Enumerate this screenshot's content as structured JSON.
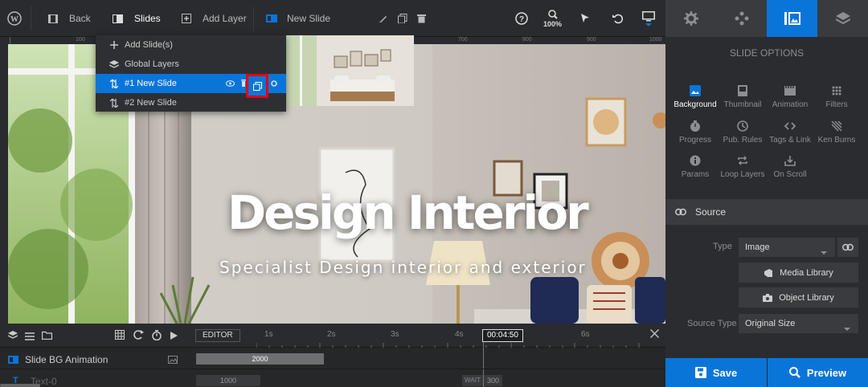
{
  "toolbar": {
    "back_label": "Back",
    "slides_label": "Slides",
    "add_layer_label": "Add Layer",
    "new_slide_label": "New Slide",
    "zoom_level": "100%"
  },
  "ruler": {
    "top_ticks": [
      "100",
      "700",
      "800",
      "900",
      "1000"
    ]
  },
  "slides_menu": {
    "items": [
      {
        "label": "Add Slide(s)"
      },
      {
        "label": "Global Layers"
      },
      {
        "label": "#1 New Slide"
      },
      {
        "label": "#2 New Slide"
      }
    ]
  },
  "canvas": {
    "headline": "Design Interior",
    "subline": "Specialist Design interior and exterior"
  },
  "timeline": {
    "editor_label": "EDITOR",
    "ticks": [
      "1s",
      "2s",
      "3s",
      "4s",
      "6s"
    ],
    "current_time": "00:04:50",
    "row1_label": "Slide BG Animation",
    "row1_bar_value": "2000",
    "row2_label": "Text-0",
    "row2_bar_value": "1000",
    "wait_label": "WAIT",
    "wait_value": "300"
  },
  "right_panel": {
    "section_title": "SLIDE OPTIONS",
    "options": [
      {
        "label": "Background"
      },
      {
        "label": "Thumbnail"
      },
      {
        "label": "Animation"
      },
      {
        "label": "Filters"
      },
      {
        "label": "Progress"
      },
      {
        "label": "Pub. Rules"
      },
      {
        "label": "Tags & Link"
      },
      {
        "label": "Ken Burns"
      },
      {
        "label": "Params"
      },
      {
        "label": "Loop Layers"
      },
      {
        "label": "On Scroll"
      }
    ],
    "source_title": "Source",
    "type_label": "Type",
    "type_value": "Image",
    "media_library_label": "Media Library",
    "object_library_label": "Object Library",
    "source_type_label": "Source Type",
    "source_type_value": "Original Size",
    "save_label": "Save",
    "preview_label": "Preview"
  },
  "colors": {
    "accent": "#0a75d9",
    "highlight": "#e3000f"
  }
}
